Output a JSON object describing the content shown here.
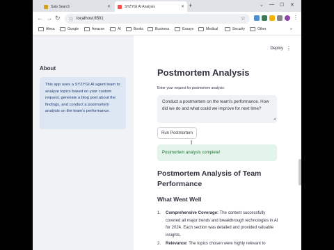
{
  "browser": {
    "tabs": [
      {
        "title": "Sats Search",
        "favicon_color": "#d4a017",
        "active": false
      },
      {
        "title": "SYZYGI AI Analysis",
        "favicon_color": "#ff4b4b",
        "active": true
      }
    ],
    "new_tab": "+",
    "window_controls": [
      "⌄",
      "—",
      "☐",
      "✕"
    ],
    "url": "localhost:8501",
    "bookmarks": [
      "Alexa",
      "Google",
      "Amazon",
      "AI",
      "Books",
      "Business",
      "Essays",
      "Medical",
      "Security",
      "Other"
    ],
    "bookmarks_more": "»",
    "extension_colors": [
      "#4a90d9",
      "#3b7a57",
      "#f4b400",
      "#e8710a",
      "#888888",
      "#8e44ad"
    ]
  },
  "app": {
    "deploy_label": "Deploy",
    "menu_icon": "⋮",
    "sidebar": {
      "about_heading": "About",
      "about_text": "This app uses a SYZYGI AI agent team to analyze topics based on your custom request, generate a blog post about the findings, and conduct a postmortem analysis on the team's performance."
    },
    "main": {
      "title": "Postmortem Analysis",
      "input_label": "Enter your request for postmortem analysis:",
      "input_value": "Conduct a postmortem on the team's performance. How did we do and what could we improve for next time?",
      "run_button": "Run Postmortem",
      "success_message": "Postmortem analysis complete!",
      "report_heading": "Postmortem Analysis of Team Performance",
      "went_well_heading": "What Went Well",
      "went_well_items": [
        {
          "num": "1.",
          "title": "Comprehensive Coverage:",
          "text": "The content successfully covered all major trends and breakthrough technologies in AI for 2024. Each section was detailed and provided valuable insights."
        },
        {
          "num": "2.",
          "title": "Relevance:",
          "text": "The topics chosen were highly relevant to"
        }
      ]
    }
  }
}
